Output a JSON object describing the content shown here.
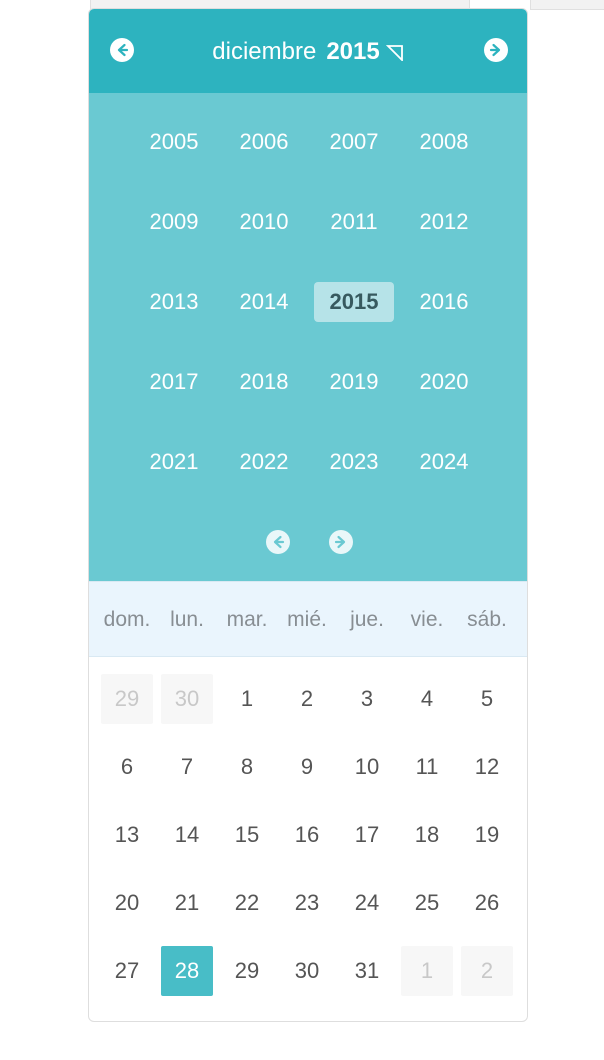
{
  "header": {
    "month": "diciembre",
    "year": "2015",
    "prev_icon": "arrow-left-circle-icon",
    "next_icon": "arrow-right-circle-icon",
    "toggle_icon": "triangle-toggle-icon"
  },
  "years_panel": {
    "years": [
      "2005",
      "2006",
      "2007",
      "2008",
      "2009",
      "2010",
      "2011",
      "2012",
      "2013",
      "2014",
      "2015",
      "2016",
      "2017",
      "2018",
      "2019",
      "2020",
      "2021",
      "2022",
      "2023",
      "2024"
    ],
    "selected": "2015"
  },
  "weekdays": [
    "dom.",
    "lun.",
    "mar.",
    "mié.",
    "jue.",
    "vie.",
    "sáb."
  ],
  "days": [
    {
      "label": "29",
      "muted": true
    },
    {
      "label": "30",
      "muted": true
    },
    {
      "label": "1"
    },
    {
      "label": "2"
    },
    {
      "label": "3"
    },
    {
      "label": "4"
    },
    {
      "label": "5"
    },
    {
      "label": "6"
    },
    {
      "label": "7"
    },
    {
      "label": "8"
    },
    {
      "label": "9"
    },
    {
      "label": "10"
    },
    {
      "label": "11"
    },
    {
      "label": "12"
    },
    {
      "label": "13"
    },
    {
      "label": "14"
    },
    {
      "label": "15"
    },
    {
      "label": "16"
    },
    {
      "label": "17"
    },
    {
      "label": "18"
    },
    {
      "label": "19"
    },
    {
      "label": "20"
    },
    {
      "label": "21"
    },
    {
      "label": "22"
    },
    {
      "label": "23"
    },
    {
      "label": "24"
    },
    {
      "label": "25"
    },
    {
      "label": "26"
    },
    {
      "label": "27"
    },
    {
      "label": "28",
      "selected": true
    },
    {
      "label": "29"
    },
    {
      "label": "30"
    },
    {
      "label": "31"
    },
    {
      "label": "1",
      "muted": true
    },
    {
      "label": "2",
      "muted": true
    }
  ],
  "colors": {
    "header": "#2db3bf",
    "years_panel": "#6ac9d2",
    "selected_year_bg": "#b6e3e8",
    "selected_day_bg": "#48bdc7",
    "weekday_bar": "#eaf5fd"
  }
}
